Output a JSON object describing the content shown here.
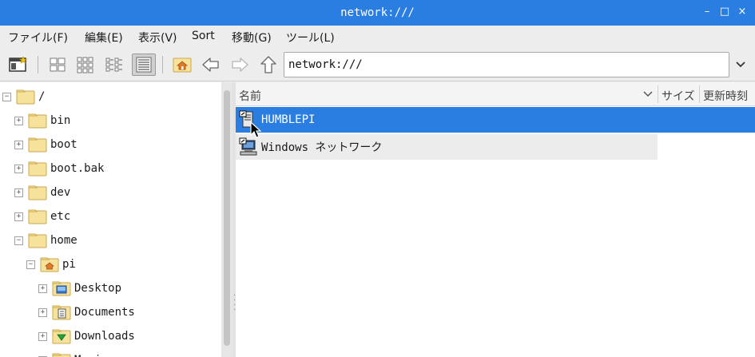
{
  "window": {
    "title": "network:///"
  },
  "window_controls": {
    "minimize": "–",
    "maximize": "□",
    "close": "×"
  },
  "menu": [
    "ファイル(F)",
    "編集(E)",
    "表示(V)",
    "Sort",
    "移動(G)",
    "ツール(L)"
  ],
  "toolbar": {
    "buttons": [
      "new-window-icon",
      "icon-view-icon",
      "thumbnail-view-icon",
      "compact-view-icon",
      "list-view-icon",
      "home-icon",
      "back-arrow-icon",
      "forward-arrow-icon",
      "up-arrow-icon"
    ],
    "active_view": "list-view-icon"
  },
  "address": {
    "value": "network:///"
  },
  "tree": {
    "items": [
      {
        "label": "/",
        "expander": "−",
        "level": 0,
        "icon": "folder-icon"
      },
      {
        "label": "bin",
        "expander": "+",
        "level": 1,
        "icon": "folder-icon"
      },
      {
        "label": "boot",
        "expander": "+",
        "level": 1,
        "icon": "folder-icon"
      },
      {
        "label": "boot.bak",
        "expander": "+",
        "level": 1,
        "icon": "folder-icon"
      },
      {
        "label": "dev",
        "expander": "+",
        "level": 1,
        "icon": "folder-icon"
      },
      {
        "label": "etc",
        "expander": "+",
        "level": 1,
        "icon": "folder-icon"
      },
      {
        "label": "home",
        "expander": "−",
        "level": 1,
        "icon": "folder-icon"
      },
      {
        "label": "pi",
        "expander": "−",
        "level": 2,
        "icon": "home-folder-icon"
      },
      {
        "label": "Desktop",
        "expander": "+",
        "level": 3,
        "icon": "desktop-folder-icon"
      },
      {
        "label": "Documents",
        "expander": "+",
        "level": 3,
        "icon": "documents-folder-icon"
      },
      {
        "label": "Downloads",
        "expander": "+",
        "level": 3,
        "icon": "downloads-folder-icon"
      },
      {
        "label": "Music",
        "expander": "+",
        "level": 3,
        "icon": "music-folder-icon"
      }
    ]
  },
  "columns": {
    "name": "名前",
    "size": "サイズ",
    "modified": "更新時刻"
  },
  "files": [
    {
      "name": "HUMBLEPI",
      "icon": "network-computer-icon",
      "selected": true
    },
    {
      "name": "Windows ネットワーク",
      "icon": "network-workgroup-icon",
      "selected": false
    }
  ],
  "colors": {
    "accent": "#2a7de1",
    "folder": "#f6e29a",
    "folder_border": "#c9a94f"
  }
}
